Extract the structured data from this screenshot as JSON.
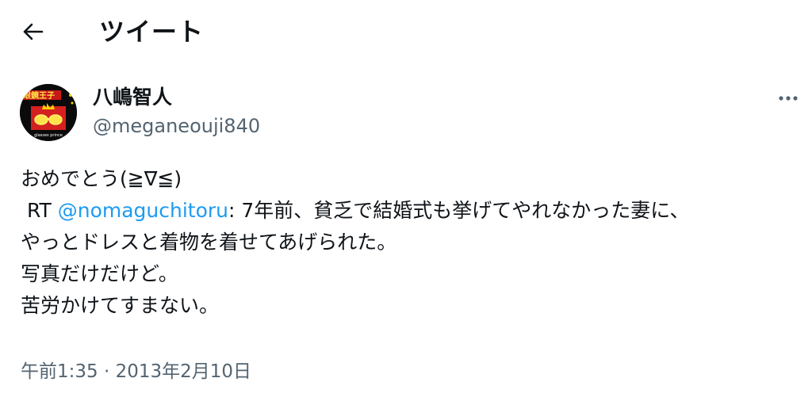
{
  "header": {
    "back_icon": "arrow-left-icon",
    "title": "ツイート"
  },
  "author": {
    "display_name": "八嶋智人",
    "handle": "@meganeouji840",
    "avatar_text_top": "眼鏡王子",
    "avatar_text_bottom": "glasses prince"
  },
  "more_icon": "more-horizontal-icon",
  "tweet": {
    "line1": "おめでとう(≧∇≦)",
    "rt_prefix": " RT ",
    "mention": "@nomaguchitoru",
    "line2_rest": ": 7年前、貧乏で結婚式も挙げてやれなかった妻に、",
    "line3": "やっとドレスと着物を着せてあげられた。",
    "line4": "写真だけだけど。",
    "line5": "苦労かけてすまない。"
  },
  "meta": {
    "time": "午前1:35",
    "separator": " · ",
    "date": "2013年2月10日"
  },
  "colors": {
    "text": "#0f1419",
    "secondary": "#536471",
    "link": "#1d9bf0"
  }
}
